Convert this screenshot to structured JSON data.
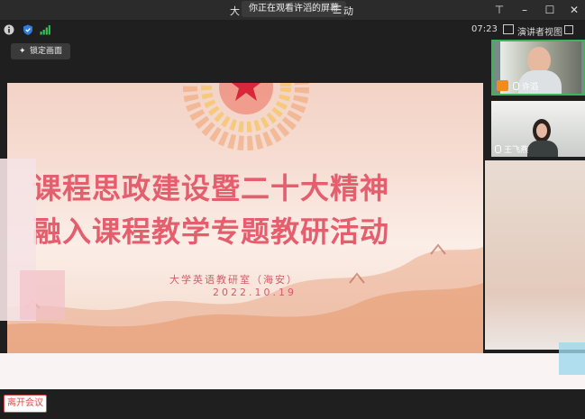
{
  "window": {
    "title_prefix": "大",
    "share_banner": "你正在观看许滔的屏幕",
    "title_suffix": "动"
  },
  "toolbar": {
    "time": "07:23",
    "view_label": "演讲者视图"
  },
  "lock_button": {
    "label": "锁定画面"
  },
  "slide": {
    "title_line1": "课程思政建设暨二十大精神",
    "title_line2": "融入课程教学专题教研活动",
    "subtitle": "大学英语教研室（海安）",
    "date": "2022.10.19"
  },
  "participants": [
    {
      "name": "许滔",
      "speaking": true
    },
    {
      "name": "王飞燕",
      "speaking": false
    }
  ],
  "leave_button": {
    "label": "离开会议"
  },
  "colors": {
    "accent_green": "#3bb55a",
    "leave_red": "#e24b4b",
    "slide_title": "#e45e6e"
  }
}
